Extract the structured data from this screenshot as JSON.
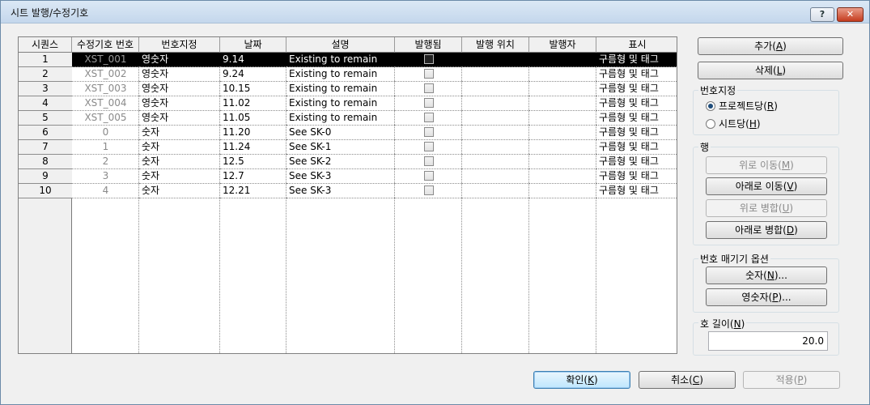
{
  "window": {
    "title": "시트 발행/수정기호",
    "help_label": "?",
    "close_label": "✕"
  },
  "table": {
    "columns": [
      "시퀀스",
      "수정기호 번호",
      "번호지정",
      "날짜",
      "설명",
      "발행됨",
      "발행 위치",
      "발행자",
      "표시"
    ],
    "rows": [
      {
        "seq": "1",
        "rev": "XST_001",
        "numbering": "영숫자",
        "date": "9.14",
        "desc": "Existing to remain",
        "issued": false,
        "issued_to": "",
        "issued_by": "",
        "show": "구름형 및 태그"
      },
      {
        "seq": "2",
        "rev": "XST_002",
        "numbering": "영숫자",
        "date": "9.24",
        "desc": "Existing to remain",
        "issued": false,
        "issued_to": "",
        "issued_by": "",
        "show": "구름형 및 태그"
      },
      {
        "seq": "3",
        "rev": "XST_003",
        "numbering": "영숫자",
        "date": "10.15",
        "desc": "Existing to remain",
        "issued": false,
        "issued_to": "",
        "issued_by": "",
        "show": "구름형 및 태그"
      },
      {
        "seq": "4",
        "rev": "XST_004",
        "numbering": "영숫자",
        "date": "11.02",
        "desc": "Existing to remain",
        "issued": false,
        "issued_to": "",
        "issued_by": "",
        "show": "구름형 및 태그"
      },
      {
        "seq": "5",
        "rev": "XST_005",
        "numbering": "영숫자",
        "date": "11.05",
        "desc": "Existing to remain",
        "issued": false,
        "issued_to": "",
        "issued_by": "",
        "show": "구름형 및 태그"
      },
      {
        "seq": "6",
        "rev": "0",
        "numbering": "숫자",
        "date": "11.20",
        "desc": "See SK-0",
        "issued": false,
        "issued_to": "",
        "issued_by": "",
        "show": "구름형 및 태그"
      },
      {
        "seq": "7",
        "rev": "1",
        "numbering": "숫자",
        "date": "11.24",
        "desc": "See SK-1",
        "issued": false,
        "issued_to": "",
        "issued_by": "",
        "show": "구름형 및 태그"
      },
      {
        "seq": "8",
        "rev": "2",
        "numbering": "숫자",
        "date": "12.5",
        "desc": "See SK-2",
        "issued": false,
        "issued_to": "",
        "issued_by": "",
        "show": "구름형 및 태그"
      },
      {
        "seq": "9",
        "rev": "3",
        "numbering": "숫자",
        "date": "12.7",
        "desc": "See SK-3",
        "issued": false,
        "issued_to": "",
        "issued_by": "",
        "show": "구름형 및 태그"
      },
      {
        "seq": "10",
        "rev": "4",
        "numbering": "숫자",
        "date": "12.21",
        "desc": "See SK-3",
        "issued": false,
        "issued_to": "",
        "issued_by": "",
        "show": "구름형 및 태그"
      }
    ]
  },
  "actions": {
    "add": {
      "text": "추가(",
      "key": "A",
      "end": ")"
    },
    "delete": {
      "text": "삭제(",
      "key": "L",
      "end": ")"
    }
  },
  "numbering": {
    "label": "번호지정",
    "per_project": {
      "text": "프로젝트당(",
      "key": "R",
      "end": ")"
    },
    "per_sheet": {
      "text": "시트당(",
      "key": "H",
      "end": ")"
    }
  },
  "row_group": {
    "label": "행",
    "move_up": {
      "text": "위로 이동(",
      "key": "M",
      "end": ")"
    },
    "move_down": {
      "text": "아래로 이동(",
      "key": "V",
      "end": ")"
    },
    "merge_up": {
      "text": "위로 병합(",
      "key": "U",
      "end": ")"
    },
    "merge_down": {
      "text": "아래로 병합(",
      "key": "D",
      "end": ")"
    }
  },
  "numbering_options": {
    "label": "번호 매기기 옵션",
    "numeric": {
      "text": "숫자(",
      "key": "N",
      "end": ")..."
    },
    "alphanumeric": {
      "text": "영숫자(",
      "key": "P",
      "end": ")..."
    }
  },
  "arc_length": {
    "text": "호 길이(",
    "key": "N",
    "end": ")",
    "value": "20.0"
  },
  "footer": {
    "ok": {
      "text": "확인(",
      "key": "K",
      "end": ")"
    },
    "cancel": {
      "text": "취소(",
      "key": "C",
      "end": ")"
    },
    "apply": {
      "text": "적용(",
      "key": "P",
      "end": ")"
    }
  },
  "colors": {
    "selected_row": "#000000",
    "default_button_border": "#3c7fb1"
  }
}
